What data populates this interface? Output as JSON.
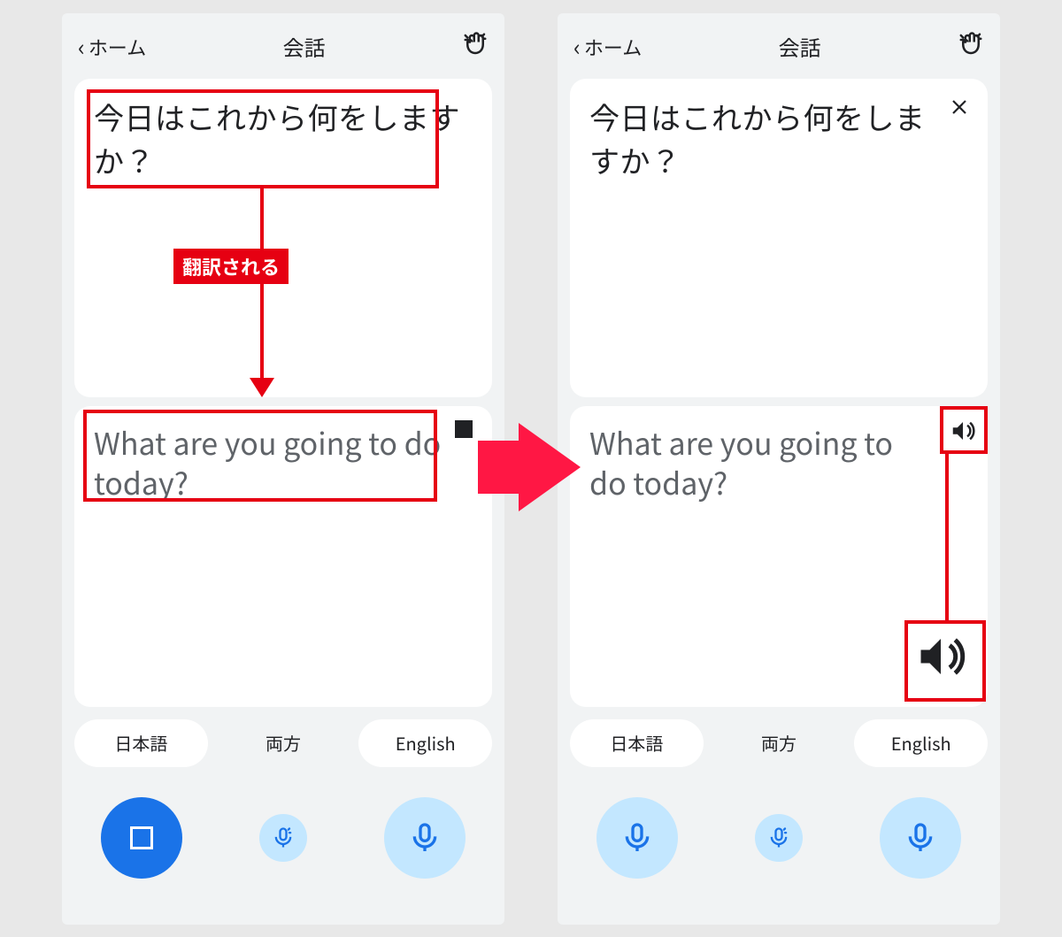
{
  "left": {
    "header": {
      "back": "ホーム",
      "title": "会話"
    },
    "source_text": "今日はこれから何をしますか？",
    "target_text": "What are you going to do today?",
    "langs": {
      "left": "日本語",
      "center": "両方",
      "right": "English"
    },
    "annotation_label": "翻訳される"
  },
  "right": {
    "header": {
      "back": "ホーム",
      "title": "会話"
    },
    "source_text": "今日はこれから何をしますか？",
    "target_text": "What are you going to do today?",
    "langs": {
      "left": "日本語",
      "center": "両方",
      "right": "English"
    }
  }
}
